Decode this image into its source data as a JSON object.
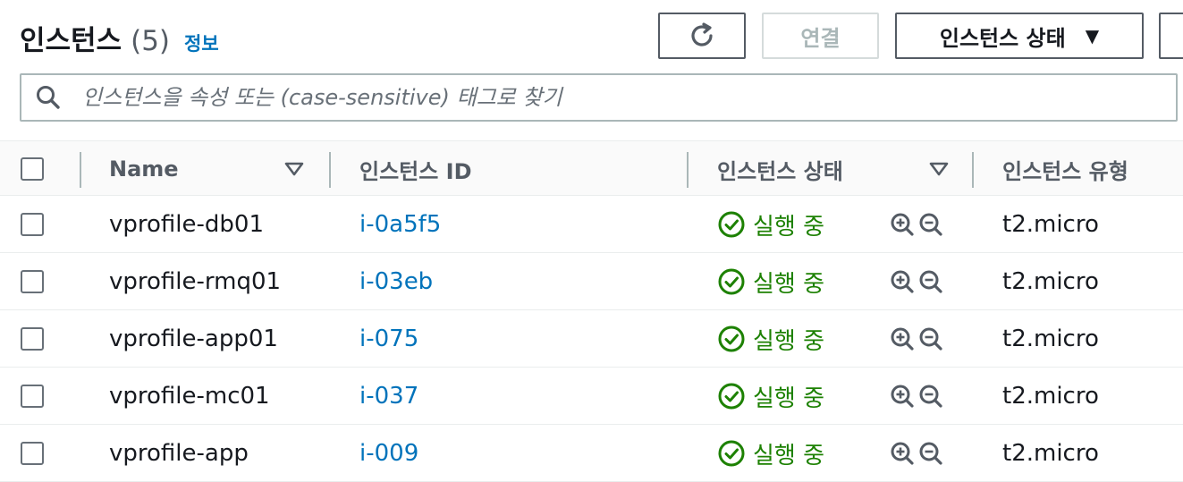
{
  "header": {
    "title": "인스턴스",
    "count": "(5)",
    "info_link": "정보",
    "connect_label": "연결",
    "state_label": "인스턴스 상태",
    "state_caret": "▼"
  },
  "search": {
    "placeholder": "인스턴스을 속성 또는 (case-sensitive) 태그로 찾기"
  },
  "table": {
    "columns": {
      "name": "Name",
      "instance_id": "인스턴스 ID",
      "instance_state": "인스턴스 상태",
      "instance_type": "인스턴스 유형"
    },
    "rows": [
      {
        "name": "vprofile-db01",
        "instance_id": "i-0a5f5",
        "status": "실행 중",
        "type": "t2.micro"
      },
      {
        "name": "vprofile-rmq01",
        "instance_id": "i-03eb",
        "status": "실행 중",
        "type": "t2.micro"
      },
      {
        "name": "vprofile-app01",
        "instance_id": "i-075",
        "status": "실행 중",
        "type": "t2.micro"
      },
      {
        "name": "vprofile-mc01",
        "instance_id": "i-037",
        "status": "실행 중",
        "type": "t2.micro"
      },
      {
        "name": "vprofile-app",
        "instance_id": "i-009",
        "status": "실행 중",
        "type": "t2.micro"
      }
    ]
  },
  "colors": {
    "link": "#0073bb",
    "success": "#1d8102",
    "text": "#16191f",
    "muted": "#545b64"
  },
  "icons": {
    "refresh": "refresh-icon",
    "search": "search-icon",
    "sort": "sort-caret-icon",
    "status": "check-circle-icon",
    "zoom_in": "zoom-in-icon",
    "zoom_out": "zoom-out-icon"
  }
}
